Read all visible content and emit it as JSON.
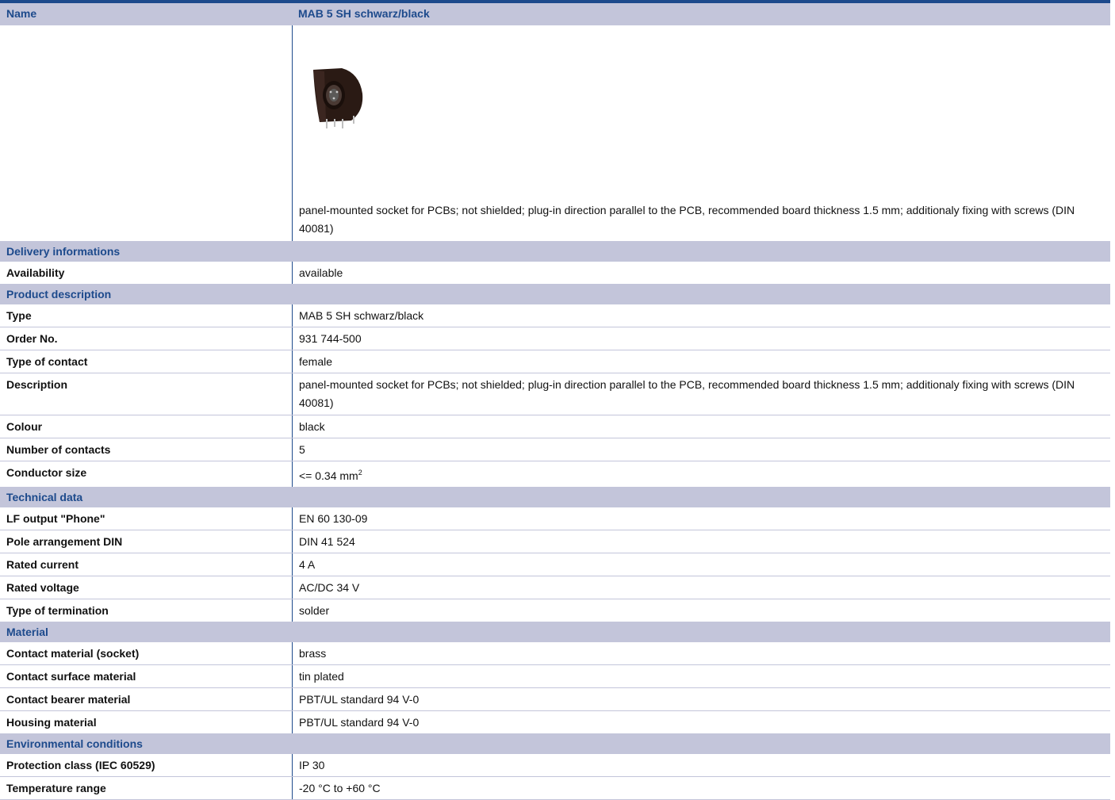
{
  "header": {
    "label": "Name",
    "value": "MAB 5 SH schwarz/black"
  },
  "product_image": {
    "alt": "MAB 5 SH panel-mounted socket"
  },
  "intro_description": "panel-mounted socket for PCBs; not shielded; plug-in direction parallel to the PCB, recommended board thickness 1.5 mm; additionaly fixing with screws (DIN 40081)",
  "sections": [
    {
      "title": "Delivery informations",
      "rows": [
        {
          "label": "Availability",
          "value": "available"
        }
      ]
    },
    {
      "title": "Product description",
      "rows": [
        {
          "label": "Type",
          "value": "MAB 5 SH schwarz/black"
        },
        {
          "label": "Order No.",
          "value": "931 744-500"
        },
        {
          "label": "Type of contact",
          "value": "female"
        },
        {
          "label": "Description",
          "value": "panel-mounted socket for PCBs; not shielded; plug-in direction parallel to the PCB, recommended board thickness 1.5 mm; additionaly fixing with screws (DIN 40081)"
        },
        {
          "label": "Colour",
          "value": "black"
        },
        {
          "label": "Number of contacts",
          "value": "5"
        },
        {
          "label": "Conductor size",
          "value": "<= 0.34 mm",
          "sup": "2"
        }
      ]
    },
    {
      "title": "Technical data",
      "rows": [
        {
          "label": "LF output \"Phone\"",
          "value": "EN 60 130-09"
        },
        {
          "label": "Pole arrangement DIN",
          "value": "DIN 41 524"
        },
        {
          "label": "Rated current",
          "value": "4 A"
        },
        {
          "label": "Rated voltage",
          "value": "AC/DC 34 V"
        },
        {
          "label": "Type of termination",
          "value": "solder"
        }
      ]
    },
    {
      "title": "Material",
      "rows": [
        {
          "label": "Contact material (socket)",
          "value": "brass"
        },
        {
          "label": "Contact surface material",
          "value": "tin plated"
        },
        {
          "label": "Contact bearer material",
          "value": "PBT/UL standard 94 V-0"
        },
        {
          "label": "Housing material",
          "value": "PBT/UL standard 94 V-0"
        }
      ]
    },
    {
      "title": "Environmental conditions",
      "rows": [
        {
          "label": "Protection class (IEC 60529)",
          "value": "IP 30"
        },
        {
          "label": "Temperature range",
          "value": "-20 °C to +60 °C"
        }
      ]
    }
  ]
}
